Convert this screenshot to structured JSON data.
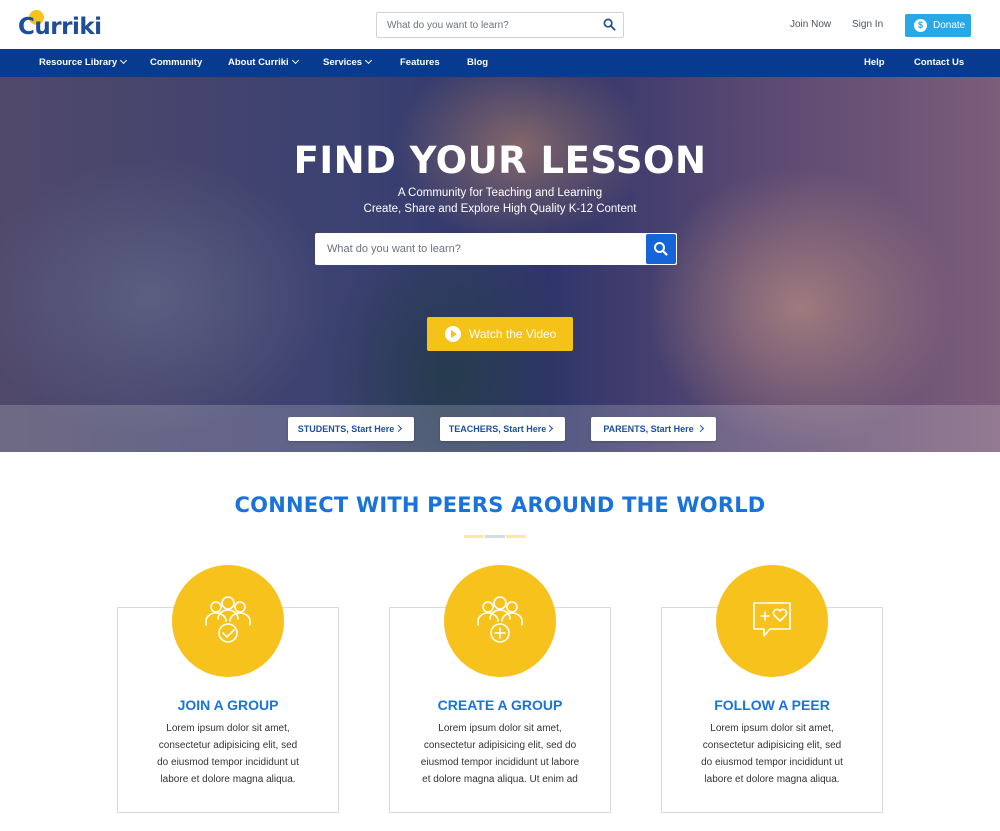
{
  "header": {
    "logo_text": "Curriki",
    "search_placeholder": "What do you want to learn?",
    "join_now": "Join Now",
    "sign_in": "Sign In",
    "donate": "Donate"
  },
  "nav": {
    "items": [
      {
        "label": "Resource Library",
        "dropdown": true
      },
      {
        "label": "Community",
        "dropdown": false
      },
      {
        "label": "About Curriki",
        "dropdown": true
      },
      {
        "label": "Services",
        "dropdown": true
      },
      {
        "label": "Features",
        "dropdown": false
      },
      {
        "label": "Blog",
        "dropdown": false
      }
    ],
    "right_items": [
      "Help",
      "Contact Us"
    ]
  },
  "hero": {
    "title": "FIND YOUR LESSON",
    "subtitle_1": "A Community for Teaching and Learning",
    "subtitle_2": "Create, Share and Explore High Quality K-12 Content",
    "search_placeholder": "What do you want to learn?",
    "watch_label": "Watch the Video",
    "start_buttons": [
      "STUDENTS, Start Here",
      "TEACHERS, Start Here",
      "PARENTS, Start Here"
    ]
  },
  "connect": {
    "title": "CONNECT WITH PEERS AROUND THE WORLD",
    "cards": [
      {
        "icon": "join-group-icon",
        "title": "JOIN A GROUP",
        "lines": [
          "Lorem ipsum dolor sit amet,",
          "consectetur adipisicing elit, sed",
          "do eiusmod tempor incididunt ut",
          "labore et dolore magna aliqua."
        ]
      },
      {
        "icon": "create-group-icon",
        "title": "CREATE A GROUP",
        "lines": [
          "Lorem ipsum dolor sit amet,",
          "consectetur adipisicing elit, sed do",
          "eiusmod tempor incididunt ut labore",
          "et dolore magna aliqua. Ut enim ad"
        ]
      },
      {
        "icon": "follow-peer-icon",
        "title": "FOLLOW A PEER",
        "lines": [
          "Lorem ipsum dolor sit amet,",
          "consectetur adipisicing elit, sed",
          "do eiusmod tempor incididunt ut",
          "labore et dolore magna aliqua."
        ]
      }
    ]
  },
  "colors": {
    "nav_bg": "#063b8f",
    "accent_blue": "#1a73d9",
    "accent_yellow": "#f7c21b",
    "donate_bg": "#27a9e6"
  }
}
